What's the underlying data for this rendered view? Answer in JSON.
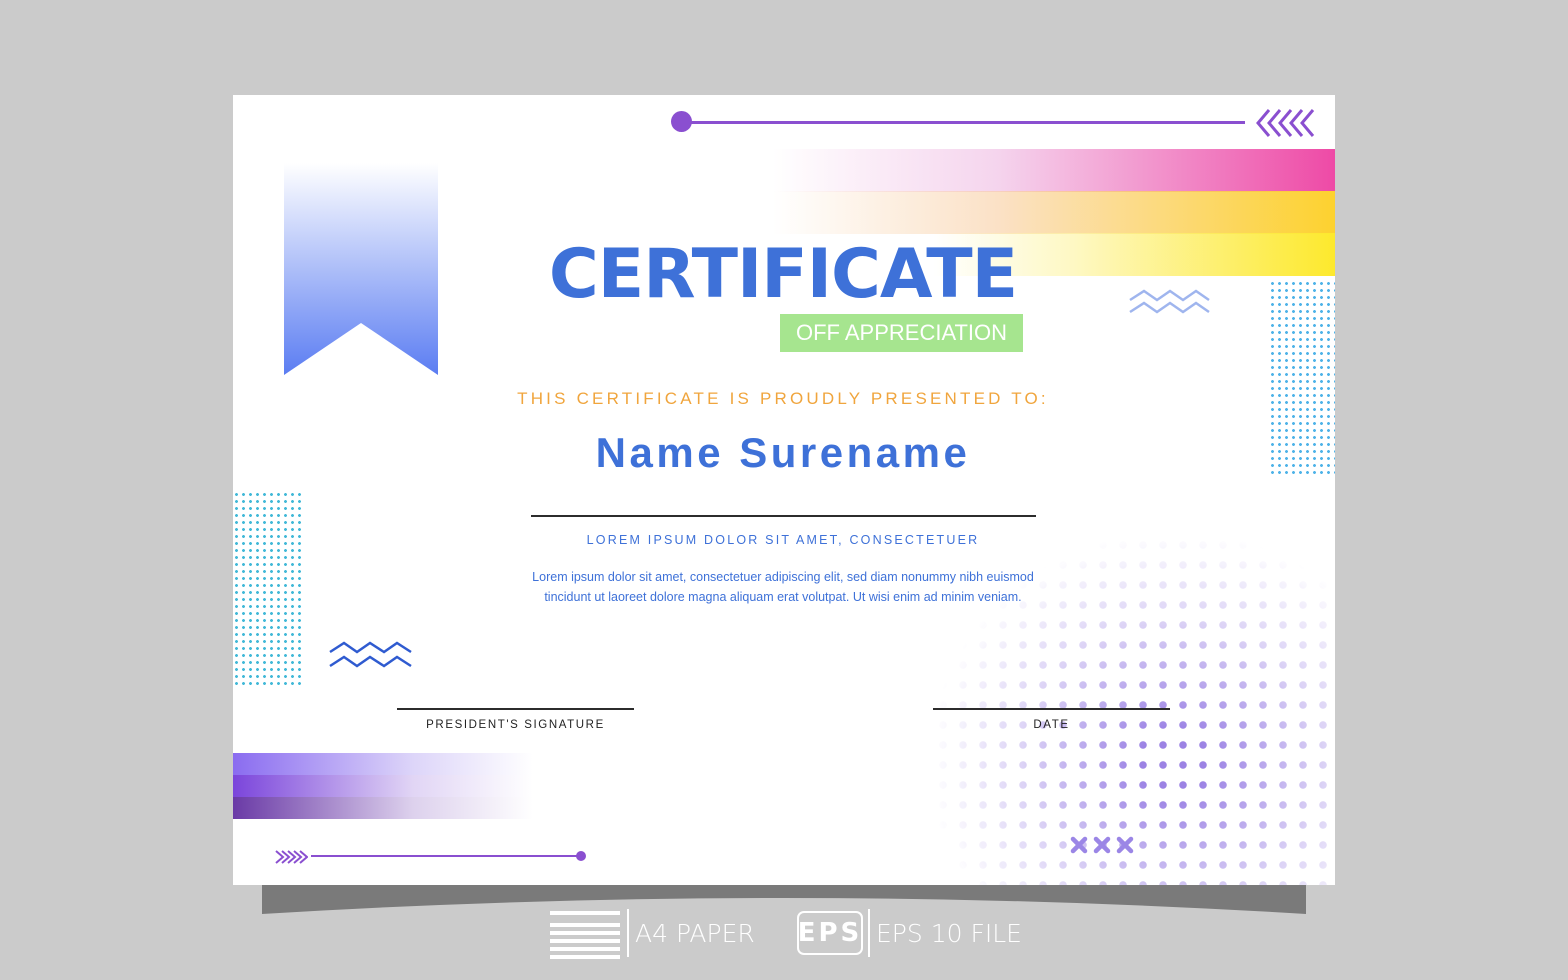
{
  "certificate": {
    "title": "CERTIFICATE",
    "subtitle": "OFF APPRECIATION",
    "presented_to": "THIS CERTIFICATE IS PROUDLY PRESENTED TO:",
    "recipient_name": "Name Surename",
    "lorem_heading": "LOREM IPSUM DOLOR SIT AMET, CONSECTETUER",
    "lorem_body_line1": "Lorem ipsum dolor sit amet, consectetuer adipiscing elit, sed diam nonummy nibh euismod",
    "lorem_body_line2": "tincidunt ut laoreet dolore magna aliquam erat volutpat. Ut wisi enim ad minim veniam.",
    "signature_left_label": "PRESIDENT'S SIGNATURE",
    "signature_right_label": "DATE"
  },
  "footer": {
    "paper_label": "A4 PAPER",
    "eps_badge": "EPS",
    "eps_label": "EPS 10 FILE"
  },
  "colors": {
    "title_blue": "#3e71d8",
    "accent_purple": "#8a4fd0",
    "subtitle_green": "#a6e58f",
    "presented_orange": "#f0a53d",
    "background_gray": "#cbcbcb"
  },
  "icons": {
    "ribbon": "bookmark-ribbon-icon",
    "chevrons": "chevron-arrows-icon",
    "zigzag": "zigzag-icon",
    "paper": "paper-lines-icon",
    "crosses": "cross-marks-icon"
  }
}
